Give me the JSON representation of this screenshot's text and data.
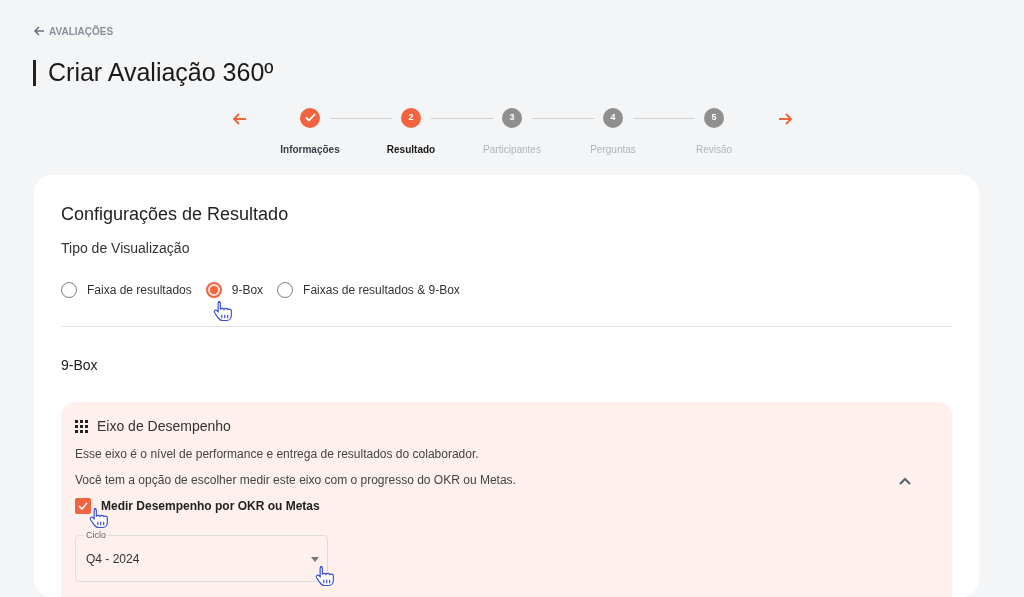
{
  "breadcrumb": {
    "label": "AVALIAÇÕES"
  },
  "title": "Criar Avaliação 360º",
  "steps": [
    {
      "label": "Informações",
      "completed": true,
      "selected": false
    },
    {
      "label": "Resultado",
      "marker": "2",
      "completed": false,
      "selected": true
    },
    {
      "label": "Participantes",
      "marker": "3",
      "completed": false,
      "selected": false
    },
    {
      "label": "Perguntas",
      "marker": "4",
      "completed": false,
      "selected": false
    },
    {
      "label": "Revisão",
      "marker": "5",
      "completed": false,
      "selected": false
    }
  ],
  "card": {
    "title": "Configurações de Resultado",
    "visualization_label": "Tipo de Visualização",
    "options": [
      {
        "label": "Faixa de resultados",
        "selected": false
      },
      {
        "label": "9-Box",
        "selected": true
      },
      {
        "label": "Faixas de resultados & 9-Box",
        "selected": false
      }
    ],
    "section_title": "9-Box",
    "axis_panel": {
      "title": "Eixo de Desempenho",
      "expanded": true,
      "description": [
        "Esse eixo é o nível de performance e entrega de resultados do colaborador.",
        "Você tem a opção de escolher medir este eixo com o progresso do OKR ou Metas."
      ],
      "checkbox": {
        "label": "Medir Desempenho por OKR ou Metas",
        "checked": true
      },
      "cycle_select": {
        "label": "Ciclo",
        "value": "Q4 - 2024"
      }
    }
  }
}
